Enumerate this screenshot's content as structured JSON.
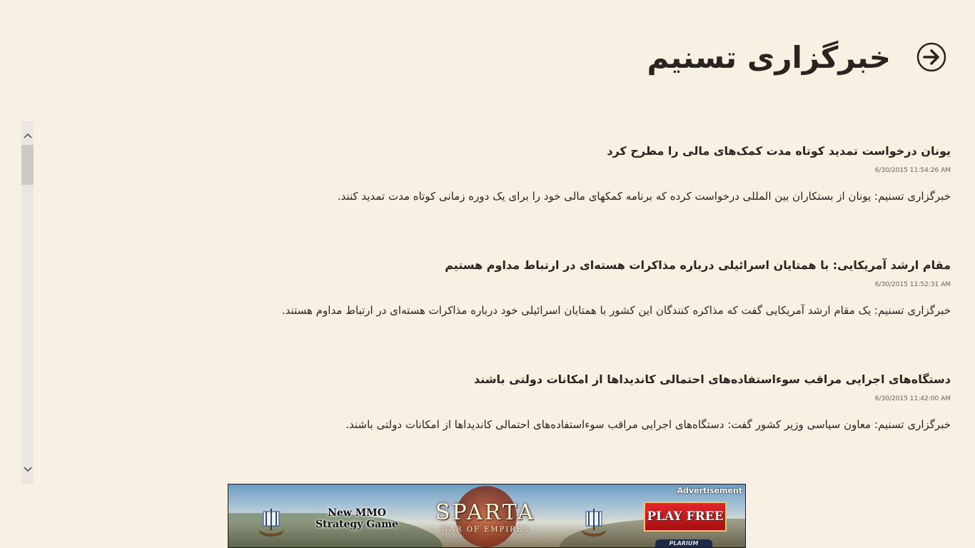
{
  "header": {
    "title": "خبرگزاری تسنیم",
    "back_icon": "arrow-right-circle-icon"
  },
  "scrollbar": {
    "up_icon": "chevron-up-icon",
    "down_icon": "chevron-down-icon"
  },
  "articles": [
    {
      "title": "یونان درخواست تمدید کوتاه مدت کمک‌های مالی را مطرح کرد",
      "time": "6/30/2015 11:54:26 AM",
      "summary": "خبرگزاری تسنیم: یونان از بستکاران بین المللی درخواست کرده که برنامه کمکهای مالی خود را برای یک دوره زمانی کوتاه مدت تمدید کنند."
    },
    {
      "title": "مقام ارشد آمریکایی: با همتایان اسرائیلی درباره مذاکرات هسته‌ای در ارتباط مداوم هستیم",
      "time": "6/30/2015 11:52:31 AM",
      "summary": "خبرگزاری تسنیم: یک مقام ارشد آمریکایی گفت که مذاکره کنندگان این کشور با همتایان اسرائیلی خود درباره مذاکرات هسته‌ای در ارتباط مداوم هستند."
    },
    {
      "title": "دستگاه‌های اجرایی مراقب سوءاستفاده‌های احتمالی کاندیداها از امکانات دولتی باشند",
      "time": "6/30/2015 11:42:00 AM",
      "summary": "خبرگزاری تسنیم: معاون سیاسی وزیر کشور گفت: دستگاه‌های اجرایی مراقب سوءاستفاده‌های احتمالی کاندیداها از امکانات دولتی باشند."
    }
  ],
  "ad": {
    "label": "Advertisement",
    "tagline_line1": "New MMO",
    "tagline_line2": "Strategy Game",
    "logo": "SPARTA",
    "logo_sub": "WAR OF EMPIRES",
    "cta": "PLAY FREE",
    "brand": "PLARIUM",
    "cta_color": "#d01a1e"
  },
  "colors": {
    "background": "#f8f0e3",
    "text": "#2a2420",
    "scrollbar_track": "#ebe7e0",
    "scrollbar_thumb": "#cdcac5"
  }
}
